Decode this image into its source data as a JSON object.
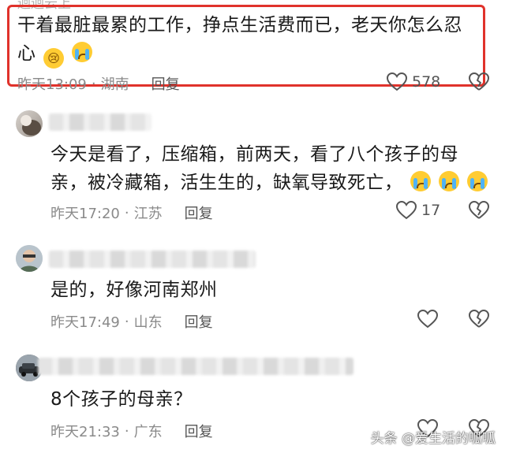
{
  "top_comment": {
    "username_clipped": "迴迴云上",
    "text_line1": "干着最脏最累的工作，挣点生活费而已，老天你怎么忍",
    "text_line2": "心",
    "time": "昨天13:09",
    "location": "湖南",
    "reply_label": "回复",
    "likes": "578"
  },
  "comments": [
    {
      "text_line1": "今天是看了，压缩箱，前两天，看了八个孩子的母",
      "text_line2": "亲，被冷藏箱，活生生的，缺氧导致死亡，",
      "time": "昨天17:20",
      "location": "江苏",
      "reply_label": "回复",
      "likes": "17"
    },
    {
      "text": "是的，好像河南郑州",
      "time": "昨天17:49",
      "location": "山东",
      "reply_label": "回复"
    },
    {
      "text": "8个孩子的母亲？",
      "time": "昨天21:33",
      "location": "广东",
      "reply_label": "回复"
    }
  ],
  "meta_separator": "·",
  "watermark": "头条 @爱生活的呱呱",
  "colors": {
    "highlight_border": "#e0322b",
    "meta_text": "#8a8a8a"
  }
}
